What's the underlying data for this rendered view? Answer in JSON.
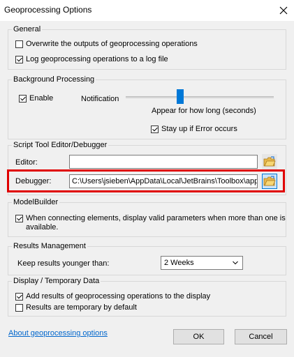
{
  "window": {
    "title": "Geoprocessing Options"
  },
  "general": {
    "legend": "General",
    "overwrite_label": "Overwrite the outputs of geoprocessing operations",
    "overwrite_checked": false,
    "log_label": "Log geoprocessing operations to a log file",
    "log_checked": true
  },
  "background": {
    "legend": "Background Processing",
    "enable_label": "Enable",
    "enable_checked": true,
    "notification_label": "Notification",
    "slider_caption": "Appear for how long (seconds)",
    "slider_level": 0.36,
    "stayup_label": "Stay up if Error occurs",
    "stayup_checked": true
  },
  "script_tool": {
    "legend": "Script Tool Editor/Debugger",
    "editor_label": "Editor:",
    "editor_value": "",
    "debugger_label": "Debugger:",
    "debugger_value": "C:\\Users\\jsieben\\AppData\\Local\\JetBrains\\Toolbox\\apps"
  },
  "modelbuilder": {
    "legend": "ModelBuilder",
    "connect_label_line1": "When connecting elements, display valid parameters when more than one is",
    "connect_label_line2": "available.",
    "connect_checked": true
  },
  "results": {
    "legend": "Results Management",
    "keep_label": "Keep results younger than:",
    "keep_value": "2 Weeks"
  },
  "display": {
    "legend": "Display / Temporary Data",
    "add_label": "Add results of geoprocessing operations to the display",
    "add_checked": true,
    "temp_label": "Results are temporary by default",
    "temp_checked": false
  },
  "footer": {
    "about_link": "About geoprocessing options",
    "ok_label": "OK",
    "cancel_label": "Cancel"
  },
  "colors": {
    "accent": "#0078d7",
    "highlight": "#e00000",
    "link": "#0066cc"
  }
}
